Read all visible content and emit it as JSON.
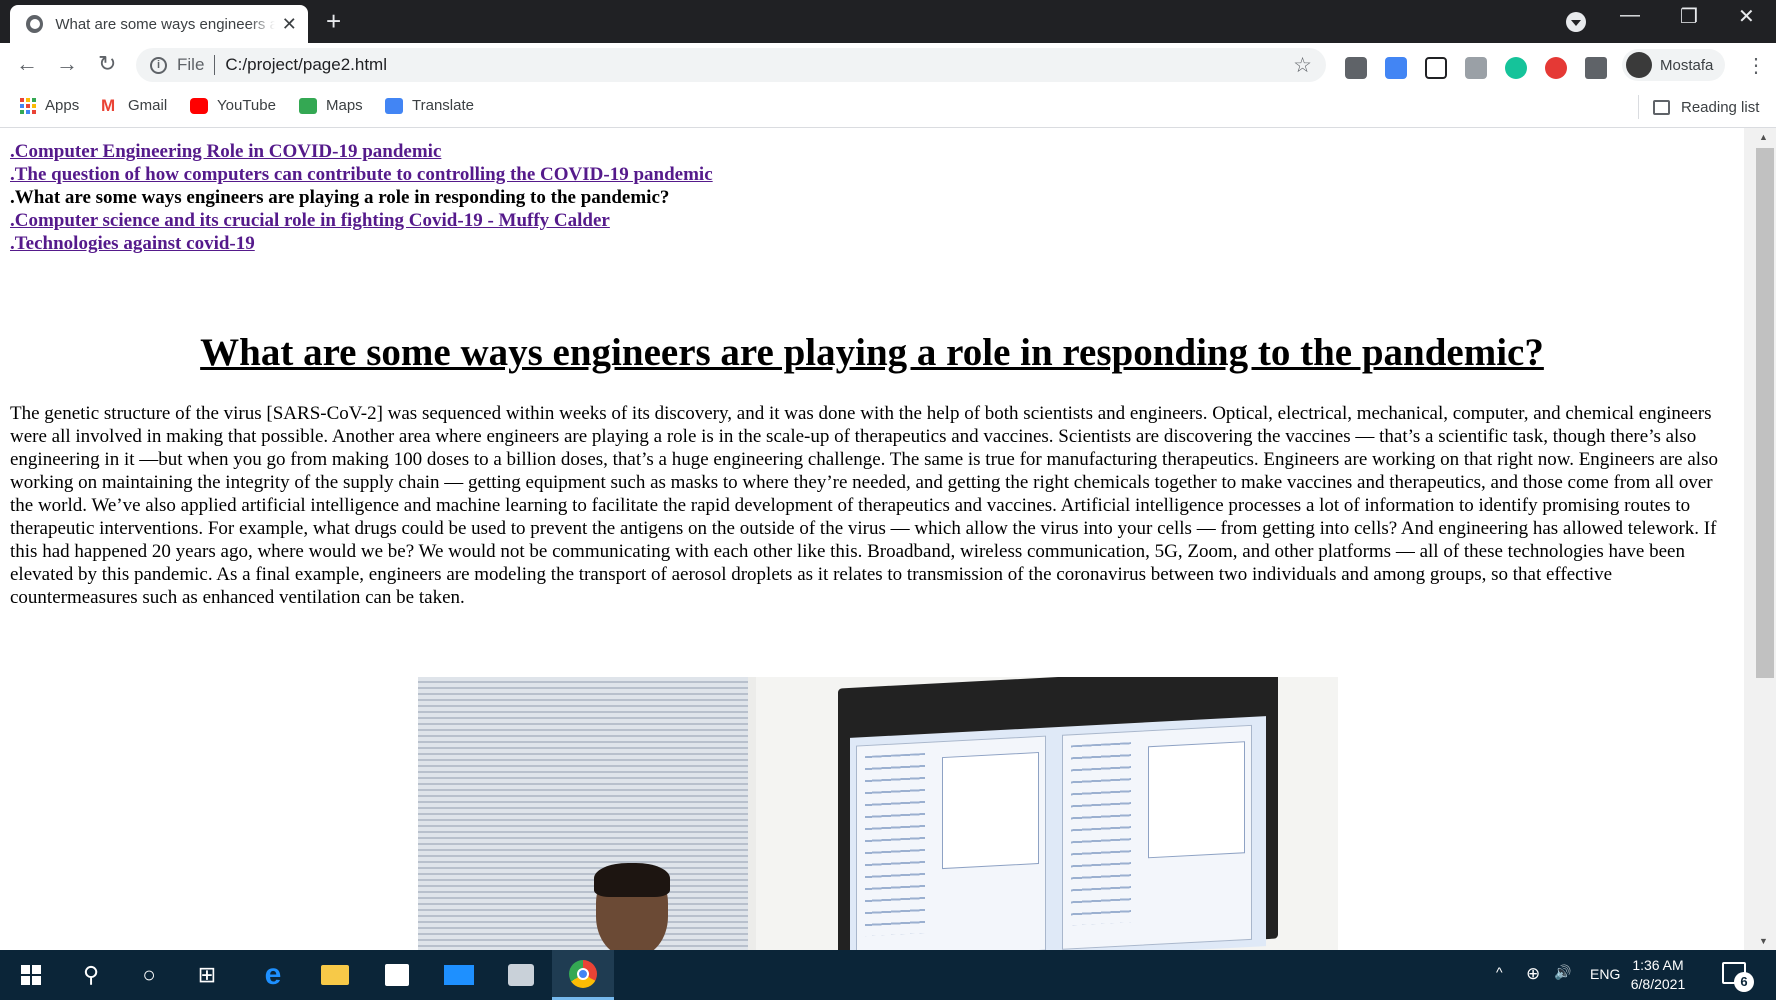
{
  "browser": {
    "tab_title": "What are some ways engineers are playing a role in responding to the pandemic?",
    "tab_close": "✕",
    "new_tab": "+",
    "address": {
      "scheme": "File",
      "url": "C:/project/page2.html"
    },
    "profile_name": "Mostafa",
    "window_controls": {
      "minimize": "—",
      "restore": "❐",
      "close": "✕"
    },
    "extensions": [
      "ext-icon",
      "translate-icon",
      "notion-icon",
      "cast-icon",
      "grammarly-icon",
      "adblock-icon",
      "puzzle-icon"
    ],
    "extension_colors": {
      "grammarly": "#15c39a",
      "adblock": "#e53935",
      "translate": "#4285f4"
    }
  },
  "bookmarks": {
    "items": [
      "Apps",
      "Gmail",
      "YouTube",
      "Maps",
      "Translate"
    ],
    "reading_list": "Reading list"
  },
  "page": {
    "nav_links": [
      ".Computer Engineering Role in COVID-19 pandemic",
      ".The question of how computers can contribute to controlling the COVID-19 pandemic",
      ".What are some ways engineers are playing a role in responding to the pandemic?",
      ".Computer science and its crucial role in fighting Covid-19 - Muffy Calder",
      ".Technologies against covid-19"
    ],
    "heading": "What are some ways engineers are playing a role in responding to the pandemic?",
    "paragraph": "The genetic structure of the virus [SARS-CoV-2] was sequenced within weeks of its discovery, and it was done with the help of both scientists and engineers. Optical, electrical, mechanical, computer, and chemical engineers were all involved in making that possible. Another area where engineers are playing a role is in the scale-up of therapeutics and vaccines. Scientists are discovering the vaccines — that’s a scientific task, though there’s also engineering in it —but when you go from making 100 doses to a billion doses, that’s a huge engineering challenge. The same is true for manufacturing therapeutics. Engineers are working on that right now. Engineers are also working on maintaining the integrity of the supply chain — getting equipment such as masks to where they’re needed, and getting the right chemicals together to make vaccines and therapeutics, and those come from all over the world. We’ve also applied artificial intelligence and machine learning to facilitate the rapid development of therapeutics and vaccines. Artificial intelligence processes a lot of information to identify promising routes to therapeutic interventions. For example, what drugs could be used to prevent the antigens on the outside of the virus — which allow the virus into your cells — from getting into cells? And engineering has allowed telework. If this had happened 20 years ago, where would we be? We would not be communicating with each other like this. Broadband, wireless communication, 5G, Zoom, and other platforms — all of these technologies have been elevated by this pandemic. As a final example, engineers are modeling the transport of aerosol droplets as it relates to transmission of the coronavirus between two individuals and among groups, so that effective countermeasures such as enhanced ventilation can be taken."
  },
  "taskbar": {
    "language": "ENG",
    "time": "1:36 AM",
    "date": "6/8/2021",
    "notification_count": "6",
    "colors": {
      "background": "#0b2538",
      "edge": "#0078d7",
      "chrome_active": "#1f3c52"
    }
  }
}
